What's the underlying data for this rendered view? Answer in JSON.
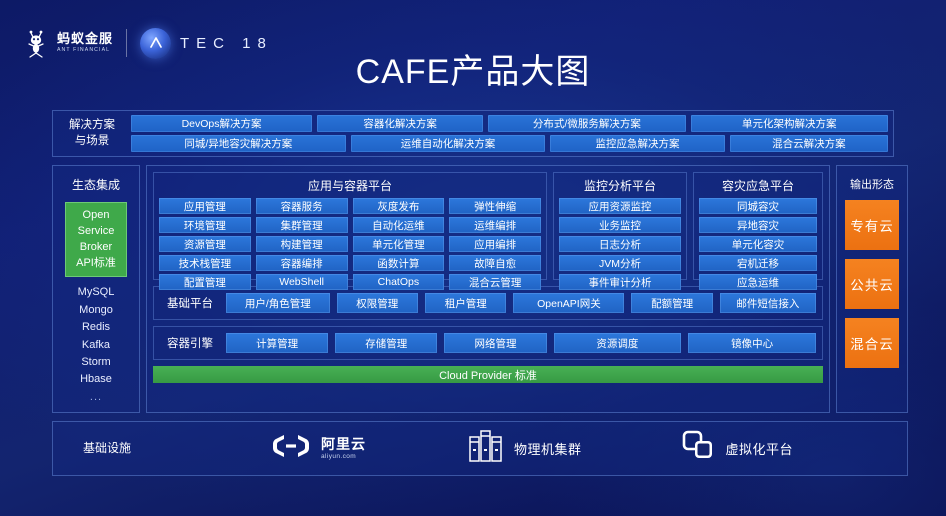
{
  "header": {
    "ant_logo_cn": "蚂蚁金服",
    "ant_logo_en": "ANT FINANCIAL",
    "atec_letters": "TEC 18",
    "atec_mark": "A"
  },
  "title": "CAFE产品大图",
  "solutions": {
    "label": "解决方案\n与场景",
    "label_line1": "解决方案",
    "label_line2": "与场景",
    "row1": [
      "DevOps解决方案",
      "容器化解决方案",
      "分布式/微服务解决方案",
      "单元化架构解决方案"
    ],
    "row2": [
      "同城/异地容灾解决方案",
      "运维自动化解决方案",
      "监控应急解决方案",
      "混合云解决方案"
    ]
  },
  "ecosystem": {
    "title": "生态集成",
    "osb": [
      "Open",
      "Service",
      "Broker",
      "API标准"
    ],
    "osb_color": "#3fa94a",
    "items": [
      "MySQL",
      "Mongo",
      "Redis",
      "Kafka",
      "Storm",
      "Hbase",
      "..."
    ]
  },
  "platforms": [
    {
      "title": "应用与容器平台",
      "columns": [
        [
          "应用管理",
          "环境管理",
          "资源管理",
          "技术栈管理",
          "配置管理"
        ],
        [
          "容器服务",
          "集群管理",
          "构建管理",
          "容器编排",
          "WebShell"
        ],
        [
          "灰度发布",
          "自动化运维",
          "单元化管理",
          "函数计算",
          "ChatOps"
        ],
        [
          "弹性伸缩",
          "运维编排",
          "应用编排",
          "故障自愈",
          "混合云管理"
        ]
      ]
    },
    {
      "title": "监控分析平台",
      "columns": [
        [
          "应用资源监控",
          "业务监控",
          "日志分析",
          "JVM分析",
          "事件审计分析"
        ]
      ]
    },
    {
      "title": "容灾应急平台",
      "columns": [
        [
          "同城容灾",
          "异地容灾",
          "单元化容灾",
          "宕机迁移",
          "应急运维"
        ]
      ]
    }
  ],
  "base_platform": {
    "label": "基础平台",
    "items": [
      "用户/角色管理",
      "权限管理",
      "租户管理",
      "OpenAPI网关",
      "配额管理",
      "邮件短信接入"
    ]
  },
  "container_engine": {
    "label": "容器引擎",
    "items": [
      "计算管理",
      "存储管理",
      "网络管理",
      "资源调度",
      "镜像中心"
    ]
  },
  "cloud_provider_bar": {
    "text": "Cloud Provider 标准",
    "color": "#3fa94a"
  },
  "output": {
    "title": "输出形态",
    "items": [
      "专有云",
      "公共云",
      "混合云"
    ],
    "color": "#f58220"
  },
  "infrastructure": {
    "label": "基础设施",
    "items": [
      {
        "icon": "alibaba-cloud-icon",
        "label_cn": "阿里云",
        "label_en": "aliyun.com"
      },
      {
        "icon": "server-rack-icon",
        "label_cn": "物理机集群",
        "label_en": ""
      },
      {
        "icon": "vmware-icon",
        "label_cn": "虚拟化平台",
        "label_en": ""
      }
    ]
  }
}
